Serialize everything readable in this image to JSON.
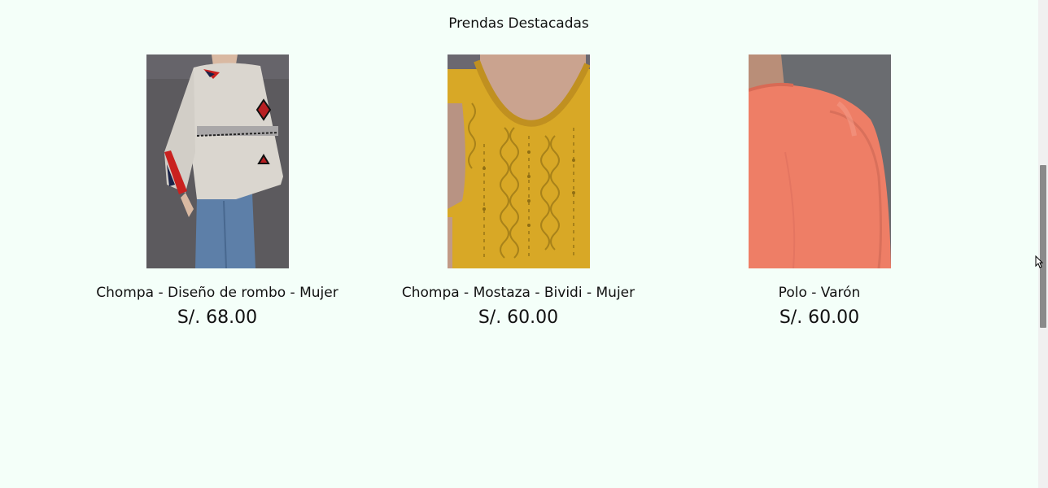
{
  "section": {
    "title": "Prendas Destacadas"
  },
  "products": [
    {
      "name": "Chompa - Diseño de rombo - Mujer",
      "price": "S/. 68.00",
      "image": "rhombus-sweater-photo"
    },
    {
      "name": "Chompa - Mostaza - Bividi - Mujer",
      "price": "S/. 60.00",
      "image": "mustard-knit-vest-photo"
    },
    {
      "name": "Polo - Varón",
      "price": "S/. 60.00",
      "image": "coral-longsleeve-shirt-photo"
    }
  ],
  "colors": {
    "background": "#f4fff9",
    "photo_backdrop": "#5a5a60",
    "mustard": "#d8a826",
    "coral": "#ee7e66"
  }
}
